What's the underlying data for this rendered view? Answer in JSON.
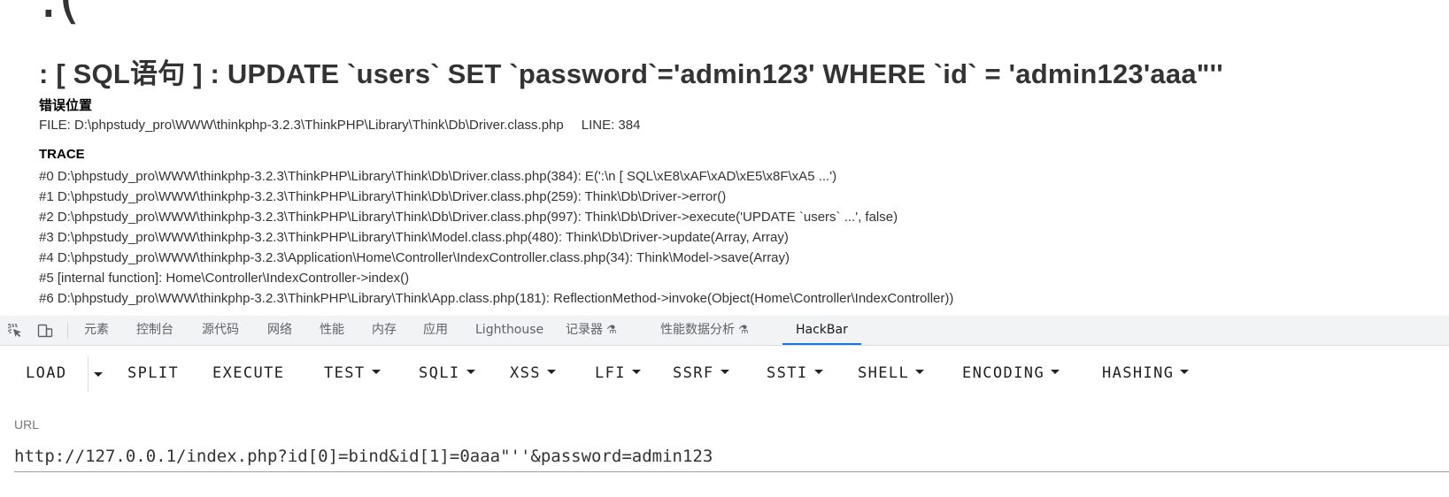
{
  "error_page": {
    "face": ":(",
    "title": ": [ SQL语句 ] : UPDATE `users` SET `password`='admin123' WHERE `id` = 'admin123'aaa\"''",
    "location_heading": "错误位置",
    "file_label": "FILE: D:\\phpstudy_pro\\WWW\\thinkphp-3.2.3\\ThinkPHP\\Library\\Think\\Db\\Driver.class.php",
    "line_label": "LINE: 384",
    "trace_heading": "TRACE",
    "trace": [
      "#0 D:\\phpstudy_pro\\WWW\\thinkphp-3.2.3\\ThinkPHP\\Library\\Think\\Db\\Driver.class.php(384): E(':\\n [ SQL\\xE8\\xAF\\xAD\\xE5\\x8F\\xA5 ...')",
      "#1 D:\\phpstudy_pro\\WWW\\thinkphp-3.2.3\\ThinkPHP\\Library\\Think\\Db\\Driver.class.php(259): Think\\Db\\Driver->error()",
      "#2 D:\\phpstudy_pro\\WWW\\thinkphp-3.2.3\\ThinkPHP\\Library\\Think\\Db\\Driver.class.php(997): Think\\Db\\Driver->execute('UPDATE `users` ...', false)",
      "#3 D:\\phpstudy_pro\\WWW\\thinkphp-3.2.3\\ThinkPHP\\Library\\Think\\Model.class.php(480): Think\\Db\\Driver->update(Array, Array)",
      "#4 D:\\phpstudy_pro\\WWW\\thinkphp-3.2.3\\Application\\Home\\Controller\\IndexController.class.php(34): Think\\Model->save(Array)",
      "#5 [internal function]: Home\\Controller\\IndexController->index()",
      "#6 D:\\phpstudy_pro\\WWW\\thinkphp-3.2.3\\ThinkPHP\\Library\\Think\\App.class.php(181): ReflectionMethod->invoke(Object(Home\\Controller\\IndexController))"
    ]
  },
  "devtools": {
    "icons": [
      "inspect-element-icon",
      "device-toolbar-icon"
    ],
    "tabs": [
      "元素",
      "控制台",
      "源代码",
      "网络",
      "性能",
      "内存",
      "应用",
      "Lighthouse",
      "记录器",
      "性能数据分析",
      "HackBar"
    ],
    "experimental_tabs": [
      "记录器",
      "性能数据分析"
    ],
    "active_tab": "HackBar",
    "accent_color": "#1a73e8"
  },
  "hackbar": {
    "buttons": [
      "LOAD",
      "SPLIT",
      "EXECUTE",
      "TEST",
      "SQLI",
      "XSS",
      "LFI",
      "SSRF",
      "SSTI",
      "SHELL",
      "ENCODING",
      "HASHING"
    ],
    "dropdown_buttons": [
      "TEST",
      "SQLI",
      "XSS",
      "LFI",
      "SSRF",
      "SSTI",
      "SHELL",
      "ENCODING",
      "HASHING"
    ],
    "url_label": "URL",
    "url_value": "http://127.0.0.1/index.php?id[0]=bind&id[1]=0aaa\"''&password=admin123"
  }
}
